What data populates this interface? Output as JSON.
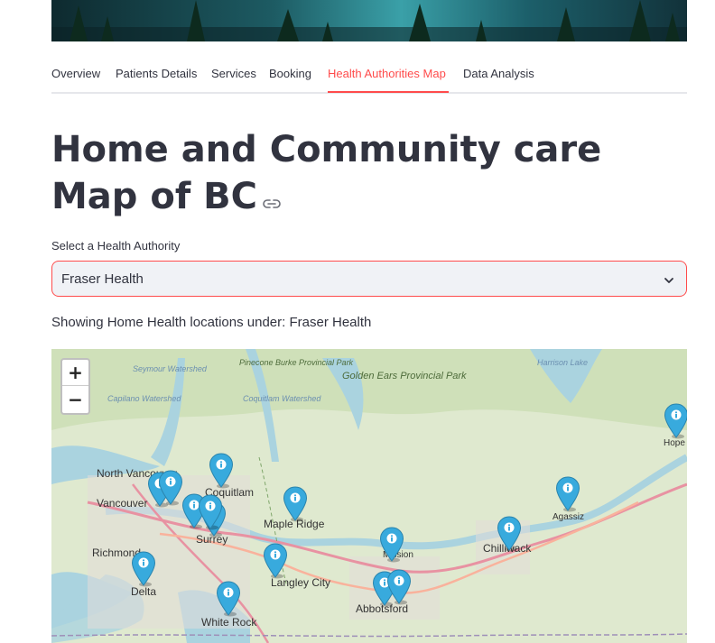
{
  "tabs": [
    {
      "label": "Overview",
      "active": false
    },
    {
      "label": "Patients Details",
      "active": false
    },
    {
      "label": "Services",
      "active": false
    },
    {
      "label": "Booking",
      "active": false
    },
    {
      "label": "Health Authorities Map",
      "active": true
    },
    {
      "label": "Data Analysis",
      "active": false
    }
  ],
  "page": {
    "title": "Home and Community care Map of BC",
    "select_label": "Select a Health Authority",
    "select_value": "Fraser Health",
    "showing_text": "Showing Home Health locations under: Fraser Health"
  },
  "map": {
    "zoom_in": "+",
    "zoom_out": "−",
    "marker_color": "#38aadd",
    "places": {
      "north_vancouver": "North Vancouver",
      "vancouver": "Vancouver",
      "coquitlam": "Coquitlam",
      "maple_ridge": "Maple Ridge",
      "richmond": "Richmond",
      "surrey": "Surrey",
      "langley_city": "Langley City",
      "delta": "Delta",
      "white_rock": "White Rock",
      "mission": "Mission",
      "abbotsford": "Abbotsford",
      "chilliwack": "Chilliwack",
      "agassiz": "Agassiz",
      "hope": "Hope",
      "harrison_lake": "Harrison Lake",
      "seymour_watershed": "Seymour Watershed",
      "capilano_watershed": "Capilano Watershed",
      "coquitlam_watershed": "Coquitlam Watershed",
      "pinecone_park": "Pinecone Burke Provincial Park",
      "golden_ears_park": "Golden Ears Provincial Park"
    }
  }
}
